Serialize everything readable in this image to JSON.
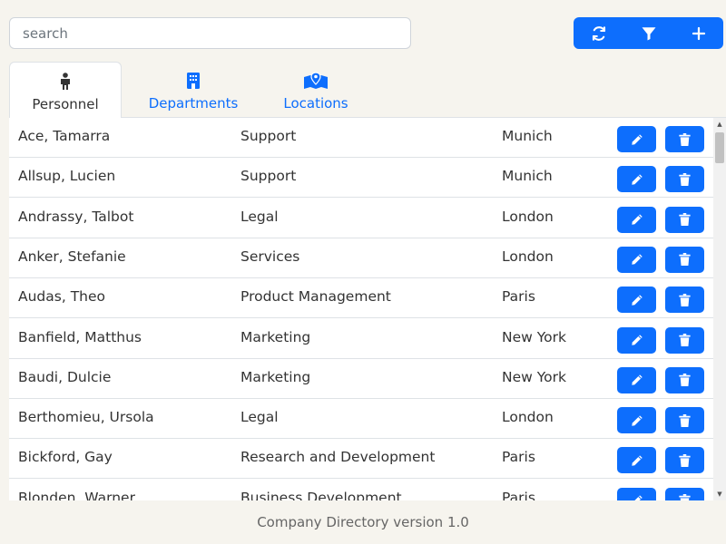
{
  "search": {
    "placeholder": "search",
    "value": ""
  },
  "toolbar": {
    "buttons": [
      {
        "name": "refresh-icon"
      },
      {
        "name": "filter-icon"
      },
      {
        "name": "plus-icon"
      }
    ],
    "color": "#0d6efd"
  },
  "tabs": [
    {
      "label": "Personnel",
      "icon": "person-icon",
      "active": true
    },
    {
      "label": "Departments",
      "icon": "building-icon",
      "active": false
    },
    {
      "label": "Locations",
      "icon": "map-location-icon",
      "active": false
    }
  ],
  "personnel": {
    "rows": [
      {
        "name": "Ace, Tamarra",
        "department": "Support",
        "location": "Munich"
      },
      {
        "name": "Allsup, Lucien",
        "department": "Support",
        "location": "Munich"
      },
      {
        "name": "Andrassy, Talbot",
        "department": "Legal",
        "location": "London"
      },
      {
        "name": "Anker, Stefanie",
        "department": "Services",
        "location": "London"
      },
      {
        "name": "Audas, Theo",
        "department": "Product Management",
        "location": "Paris"
      },
      {
        "name": "Banfield, Matthus",
        "department": "Marketing",
        "location": "New York"
      },
      {
        "name": "Baudi, Dulcie",
        "department": "Marketing",
        "location": "New York"
      },
      {
        "name": "Berthomieu, Ursola",
        "department": "Legal",
        "location": "London"
      },
      {
        "name": "Bickford, Gay",
        "department": "Research and Development",
        "location": "Paris"
      },
      {
        "name": "Blonden, Warner",
        "department": "Business Development",
        "location": "Paris"
      }
    ]
  },
  "footer": {
    "text": "Company Directory version 1.0"
  }
}
